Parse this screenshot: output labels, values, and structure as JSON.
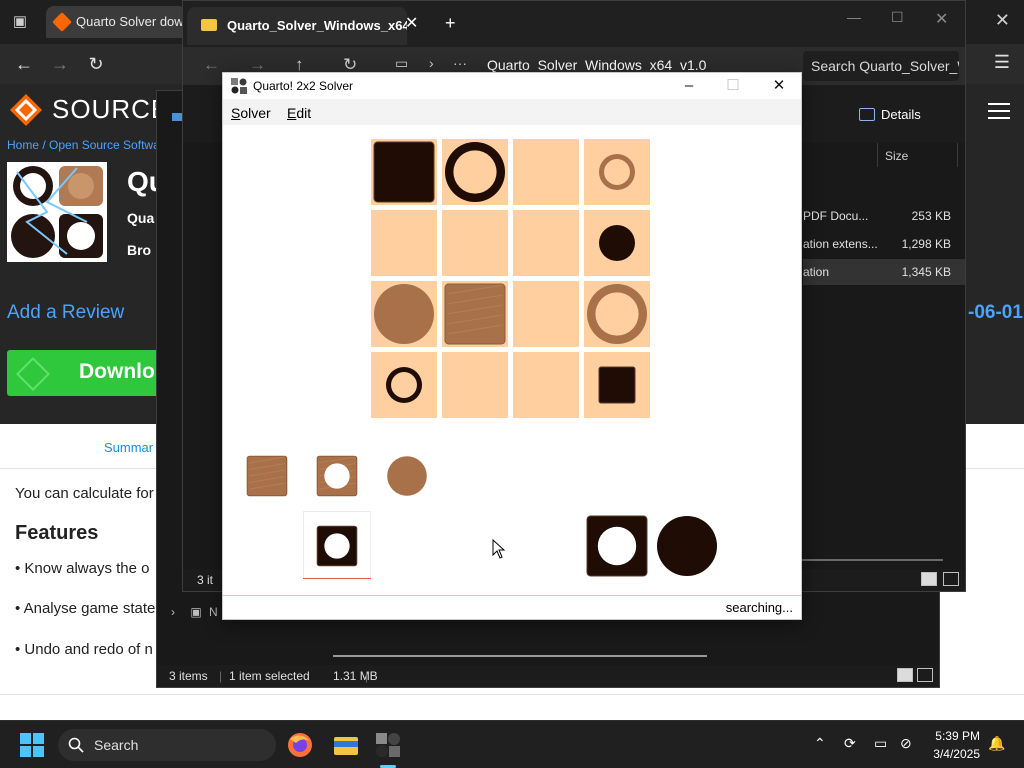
{
  "browser": {
    "tab_title": "Quarto Solver down",
    "colors": {
      "tab_bg": "#3b3b3b",
      "content_bg": "#262626",
      "link": "#4aa3ff",
      "download": "#2fc83c"
    }
  },
  "sourceforge": {
    "logo_text": "SOURCEF",
    "breadcrumb": "Home / Open Source Softwa",
    "title": "Qu",
    "sub1": "Qua",
    "sub2": "Bro",
    "add_review": "Add a Review",
    "date_fragment": "-06-01",
    "download": "Downlo",
    "summary_tab": "Summar",
    "intro": "You can calculate for",
    "features_heading": "Features",
    "bullets": [
      "• Know always the o",
      "• Analyse game state",
      "• Undo and redo of n"
    ]
  },
  "explorer": {
    "tab_title": "Quarto_Solver_Windows_x64_v",
    "address": "Quarto_Solver_Windows_x64_v1.0",
    "search_placeholder": "Search Quarto_Solver_Wi",
    "details_label": "Details",
    "size_header": "Size",
    "rows": [
      {
        "type": "PDF Docu...",
        "size": "253 KB",
        "selected": false
      },
      {
        "type": "ation extens...",
        "size": "1,298 KB",
        "selected": false
      },
      {
        "type": "ation",
        "size": "1,345 KB",
        "selected": true
      }
    ],
    "status_items": "3 it"
  },
  "explorer2": {
    "sidebar_network": "N",
    "status_items": "3 items",
    "status_selected": "1 item selected",
    "status_size": "1.31 MB"
  },
  "solver": {
    "title": "Quarto! 2x2 Solver",
    "menu": [
      {
        "label_u": "S",
        "label_rest": "olver"
      },
      {
        "label_u": "E",
        "label_rest": "dit"
      }
    ],
    "status": "searching...",
    "icons": {
      "minimize": "–",
      "maximize": "☐",
      "close": "✕"
    },
    "colors": {
      "cell": "#ffcfa0",
      "dark": "#1e0c05",
      "wood": "#a8714a",
      "status_line": "#e9c3b0"
    },
    "board": [
      [
        {
          "color": "dark",
          "shape": "square",
          "hole": false
        },
        {
          "color": "dark",
          "shape": "circle",
          "hole": true
        },
        null,
        {
          "color": "wood",
          "shape": "circle",
          "hole": true,
          "small": true
        }
      ],
      [
        null,
        null,
        null,
        {
          "color": "dark",
          "shape": "circle",
          "hole": false,
          "small": true
        }
      ],
      [
        {
          "color": "wood",
          "shape": "circle",
          "hole": false
        },
        {
          "color": "wood",
          "shape": "square",
          "hole": false
        },
        null,
        {
          "color": "wood",
          "shape": "circle",
          "hole": true
        }
      ],
      [
        {
          "color": "dark",
          "shape": "circle",
          "hole": true,
          "small": true
        },
        null,
        null,
        {
          "color": "dark",
          "shape": "square",
          "hole": false,
          "small": true
        }
      ]
    ],
    "available_pieces": [
      {
        "color": "wood",
        "shape": "square",
        "hole": false,
        "small": true
      },
      {
        "color": "wood",
        "shape": "square",
        "hole": true,
        "small": true
      },
      {
        "color": "wood",
        "shape": "circle",
        "hole": false,
        "small": true
      }
    ],
    "selected_piece": {
      "color": "dark",
      "shape": "square",
      "hole": true,
      "small": true
    },
    "large_pieces": [
      {
        "color": "dark",
        "shape": "square",
        "hole": true,
        "small": false
      },
      {
        "color": "dark",
        "shape": "circle",
        "hole": false,
        "small": false
      }
    ]
  },
  "taskbar": {
    "search_label": "Search",
    "time": "5:39 PM",
    "date": "3/4/2025",
    "apps": [
      "firefox-icon",
      "file-explorer-icon",
      "quarto-solver-icon"
    ]
  }
}
